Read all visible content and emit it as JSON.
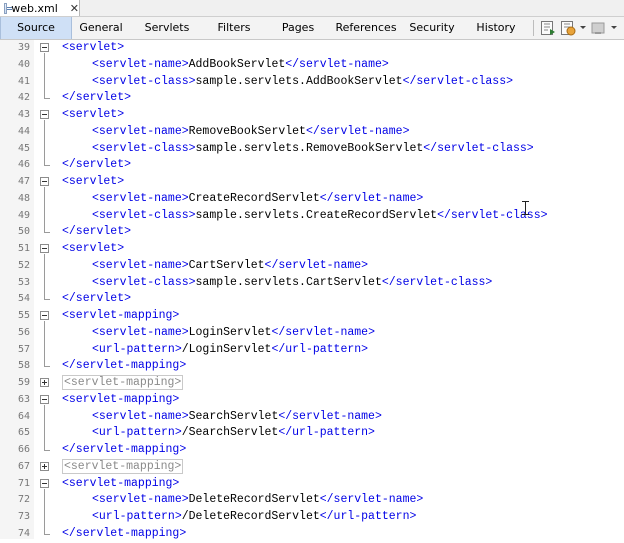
{
  "file_tab": {
    "name": "web.xml",
    "close": "✕"
  },
  "view_tabs": [
    {
      "label": "Source",
      "active": true
    },
    {
      "label": "General",
      "active": false
    },
    {
      "label": "Servlets",
      "active": false
    },
    {
      "label": "Filters",
      "active": false
    },
    {
      "label": "Pages",
      "active": false
    },
    {
      "label": "References",
      "active": false
    },
    {
      "label": "Security",
      "active": false
    },
    {
      "label": "History",
      "active": false
    }
  ],
  "toolbar_icons": [
    "back-history-icon",
    "forward-history-icon",
    "disabled-action-icon"
  ],
  "colors": {
    "tag": "#0000e6",
    "text": "#000000",
    "active_tab": "#cfe0f6"
  },
  "lines": [
    {
      "n": "39",
      "fold": "minus",
      "indent": 1,
      "parts": [
        {
          "t": "tag",
          "v": "<servlet>"
        }
      ]
    },
    {
      "n": "40",
      "fold": "",
      "indent": 2,
      "parts": [
        {
          "t": "tag",
          "v": "<servlet-name>"
        },
        {
          "t": "txt",
          "v": "AddBookServlet"
        },
        {
          "t": "tag",
          "v": "</servlet-name>"
        }
      ]
    },
    {
      "n": "41",
      "fold": "",
      "indent": 2,
      "parts": [
        {
          "t": "tag",
          "v": "<servlet-class>"
        },
        {
          "t": "txt",
          "v": "sample.servlets.AddBookServlet"
        },
        {
          "t": "tag",
          "v": "</servlet-class>"
        }
      ]
    },
    {
      "n": "42",
      "fold": "end",
      "indent": 1,
      "parts": [
        {
          "t": "tag",
          "v": "</servlet>"
        }
      ]
    },
    {
      "n": "43",
      "fold": "minus",
      "indent": 1,
      "parts": [
        {
          "t": "tag",
          "v": "<servlet>"
        }
      ]
    },
    {
      "n": "44",
      "fold": "",
      "indent": 2,
      "parts": [
        {
          "t": "tag",
          "v": "<servlet-name>"
        },
        {
          "t": "txt",
          "v": "RemoveBookServlet"
        },
        {
          "t": "tag",
          "v": "</servlet-name>"
        }
      ]
    },
    {
      "n": "45",
      "fold": "",
      "indent": 2,
      "parts": [
        {
          "t": "tag",
          "v": "<servlet-class>"
        },
        {
          "t": "txt",
          "v": "sample.servlets.RemoveBookServlet"
        },
        {
          "t": "tag",
          "v": "</servlet-class>"
        }
      ]
    },
    {
      "n": "46",
      "fold": "end",
      "indent": 1,
      "parts": [
        {
          "t": "tag",
          "v": "</servlet>"
        }
      ]
    },
    {
      "n": "47",
      "fold": "minus",
      "indent": 1,
      "parts": [
        {
          "t": "tag",
          "v": "<servlet>"
        }
      ]
    },
    {
      "n": "48",
      "fold": "",
      "indent": 2,
      "parts": [
        {
          "t": "tag",
          "v": "<servlet-name>"
        },
        {
          "t": "txt",
          "v": "CreateRecordServlet"
        },
        {
          "t": "tag",
          "v": "</servlet-name>"
        }
      ]
    },
    {
      "n": "49",
      "fold": "",
      "indent": 2,
      "parts": [
        {
          "t": "tag",
          "v": "<servlet-class>"
        },
        {
          "t": "txt",
          "v": "sample.servlets.CreateRecordServlet"
        },
        {
          "t": "tag",
          "v": "</servlet-class>"
        }
      ]
    },
    {
      "n": "50",
      "fold": "end",
      "indent": 1,
      "parts": [
        {
          "t": "tag",
          "v": "</servlet>"
        }
      ]
    },
    {
      "n": "51",
      "fold": "minus",
      "indent": 1,
      "parts": [
        {
          "t": "tag",
          "v": "<servlet>"
        }
      ]
    },
    {
      "n": "52",
      "fold": "",
      "indent": 2,
      "parts": [
        {
          "t": "tag",
          "v": "<servlet-name>"
        },
        {
          "t": "txt",
          "v": "CartServlet"
        },
        {
          "t": "tag",
          "v": "</servlet-name>"
        }
      ]
    },
    {
      "n": "53",
      "fold": "",
      "indent": 2,
      "parts": [
        {
          "t": "tag",
          "v": "<servlet-class>"
        },
        {
          "t": "txt",
          "v": "sample.servlets.CartServlet"
        },
        {
          "t": "tag",
          "v": "</servlet-class>"
        }
      ]
    },
    {
      "n": "54",
      "fold": "end",
      "indent": 1,
      "parts": [
        {
          "t": "tag",
          "v": "</servlet>"
        }
      ]
    },
    {
      "n": "55",
      "fold": "minus",
      "indent": 1,
      "parts": [
        {
          "t": "tag",
          "v": "<servlet-mapping>"
        }
      ]
    },
    {
      "n": "56",
      "fold": "",
      "indent": 2,
      "parts": [
        {
          "t": "tag",
          "v": "<servlet-name>"
        },
        {
          "t": "txt",
          "v": "LoginServlet"
        },
        {
          "t": "tag",
          "v": "</servlet-name>"
        }
      ]
    },
    {
      "n": "57",
      "fold": "",
      "indent": 2,
      "parts": [
        {
          "t": "tag",
          "v": "<url-pattern>"
        },
        {
          "t": "txt",
          "v": "/LoginServlet"
        },
        {
          "t": "tag",
          "v": "</url-pattern>"
        }
      ]
    },
    {
      "n": "58",
      "fold": "end",
      "indent": 1,
      "parts": [
        {
          "t": "tag",
          "v": "</servlet-mapping>"
        }
      ]
    },
    {
      "n": "59",
      "fold": "plus",
      "indent": 1,
      "parts": [
        {
          "t": "collapsed",
          "v": "<servlet-mapping>"
        }
      ]
    },
    {
      "n": "63",
      "fold": "minus",
      "indent": 1,
      "parts": [
        {
          "t": "tag",
          "v": "<servlet-mapping>"
        }
      ]
    },
    {
      "n": "64",
      "fold": "",
      "indent": 2,
      "parts": [
        {
          "t": "tag",
          "v": "<servlet-name>"
        },
        {
          "t": "txt",
          "v": "SearchServlet"
        },
        {
          "t": "tag",
          "v": "</servlet-name>"
        }
      ]
    },
    {
      "n": "65",
      "fold": "",
      "indent": 2,
      "parts": [
        {
          "t": "tag",
          "v": "<url-pattern>"
        },
        {
          "t": "txt",
          "v": "/SearchServlet"
        },
        {
          "t": "tag",
          "v": "</url-pattern>"
        }
      ]
    },
    {
      "n": "66",
      "fold": "end",
      "indent": 1,
      "parts": [
        {
          "t": "tag",
          "v": "</servlet-mapping>"
        }
      ]
    },
    {
      "n": "67",
      "fold": "plus",
      "indent": 1,
      "parts": [
        {
          "t": "collapsed",
          "v": "<servlet-mapping>"
        }
      ]
    },
    {
      "n": "71",
      "fold": "minus",
      "indent": 1,
      "parts": [
        {
          "t": "tag",
          "v": "<servlet-mapping>"
        }
      ]
    },
    {
      "n": "72",
      "fold": "",
      "indent": 2,
      "parts": [
        {
          "t": "tag",
          "v": "<servlet-name>"
        },
        {
          "t": "txt",
          "v": "DeleteRecordServlet"
        },
        {
          "t": "tag",
          "v": "</servlet-name>"
        }
      ]
    },
    {
      "n": "73",
      "fold": "",
      "indent": 2,
      "parts": [
        {
          "t": "tag",
          "v": "<url-pattern>"
        },
        {
          "t": "txt",
          "v": "/DeleteRecordServlet"
        },
        {
          "t": "tag",
          "v": "</url-pattern>"
        }
      ]
    },
    {
      "n": "74",
      "fold": "end",
      "indent": 1,
      "parts": [
        {
          "t": "tag",
          "v": "</servlet-mapping>"
        }
      ]
    }
  ]
}
